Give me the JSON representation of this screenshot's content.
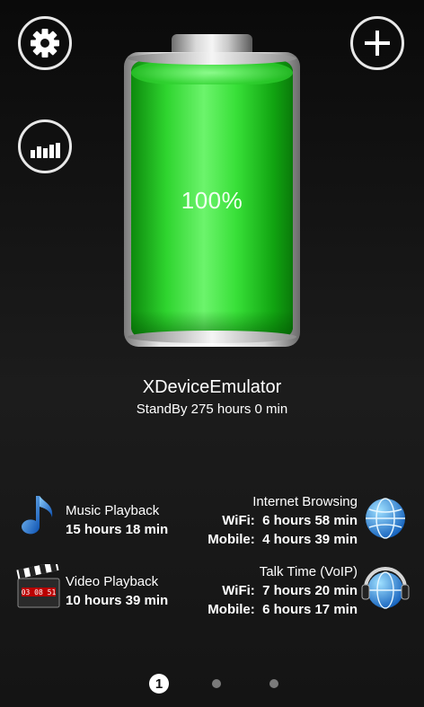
{
  "battery": {
    "percent_label": "100%",
    "level": 1.0,
    "fill_color": "#2fd52f"
  },
  "device": {
    "name": "XDeviceEmulator",
    "standby": "StandBy 275 hours 0 min"
  },
  "buttons": {
    "settings_icon": "gear-icon",
    "add_icon": "plus-icon",
    "stats_icon": "signal-bars-icon"
  },
  "stats": {
    "music": {
      "label": "Music Playback",
      "value": "15 hours 18 min",
      "icon": "music-note-icon"
    },
    "video": {
      "label": "Video Playback",
      "value": "10 hours 39 min",
      "icon": "clapperboard-icon"
    },
    "internet": {
      "label": "Internet Browsing",
      "wifi_prefix": "WiFi:",
      "wifi_value": "6 hours 58 min",
      "mobile_prefix": "Mobile:",
      "mobile_value": "4 hours 39 min",
      "icon": "globe-icon"
    },
    "talk": {
      "label": "Talk Time  (VoIP)",
      "wifi_prefix": "WiFi:",
      "wifi_value": "7 hours 20 min",
      "mobile_prefix": "Mobile:",
      "mobile_value": "6 hours 17 min",
      "icon": "headset-globe-icon"
    }
  },
  "pager": {
    "current_page": "1",
    "total_pages": 3
  },
  "clapper_text": "03 08 51"
}
